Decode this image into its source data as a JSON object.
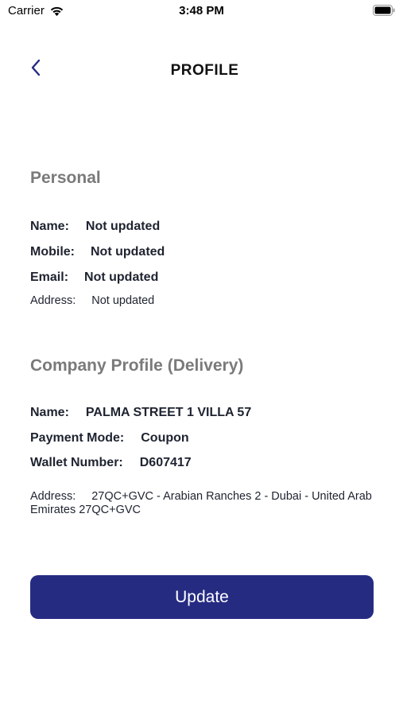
{
  "status_bar": {
    "carrier": "Carrier",
    "time": "3:48 PM",
    "icons": [
      "wifi-icon",
      "battery-icon"
    ]
  },
  "header": {
    "title": "PROFILE",
    "back_icon": "chevron-left-icon"
  },
  "personal": {
    "title": "Personal",
    "name_label": "Name:",
    "name_value": "Not updated",
    "mobile_label": "Mobile:",
    "mobile_value": "Not updated",
    "email_label": "Email:",
    "email_value": "Not updated",
    "address_label": "Address:",
    "address_value": "Not updated"
  },
  "company": {
    "title": "Company Profile (Delivery)",
    "name_label": "Name:",
    "name_value": "PALMA STREET 1 VILLA 57",
    "payment_label": "Payment Mode:",
    "payment_value": "Coupon",
    "wallet_label": "Wallet Number:",
    "wallet_value": "D607417",
    "address_label": "Address:",
    "address_value": "27QC+GVC - Arabian Ranches 2 - Dubai - United Arab Emirates 27QC+GVC"
  },
  "actions": {
    "update_label": "Update"
  },
  "colors": {
    "accent": "#262b82",
    "section_title": "#7a7a7a",
    "text": "#1e2330",
    "background": "#ffffff"
  }
}
